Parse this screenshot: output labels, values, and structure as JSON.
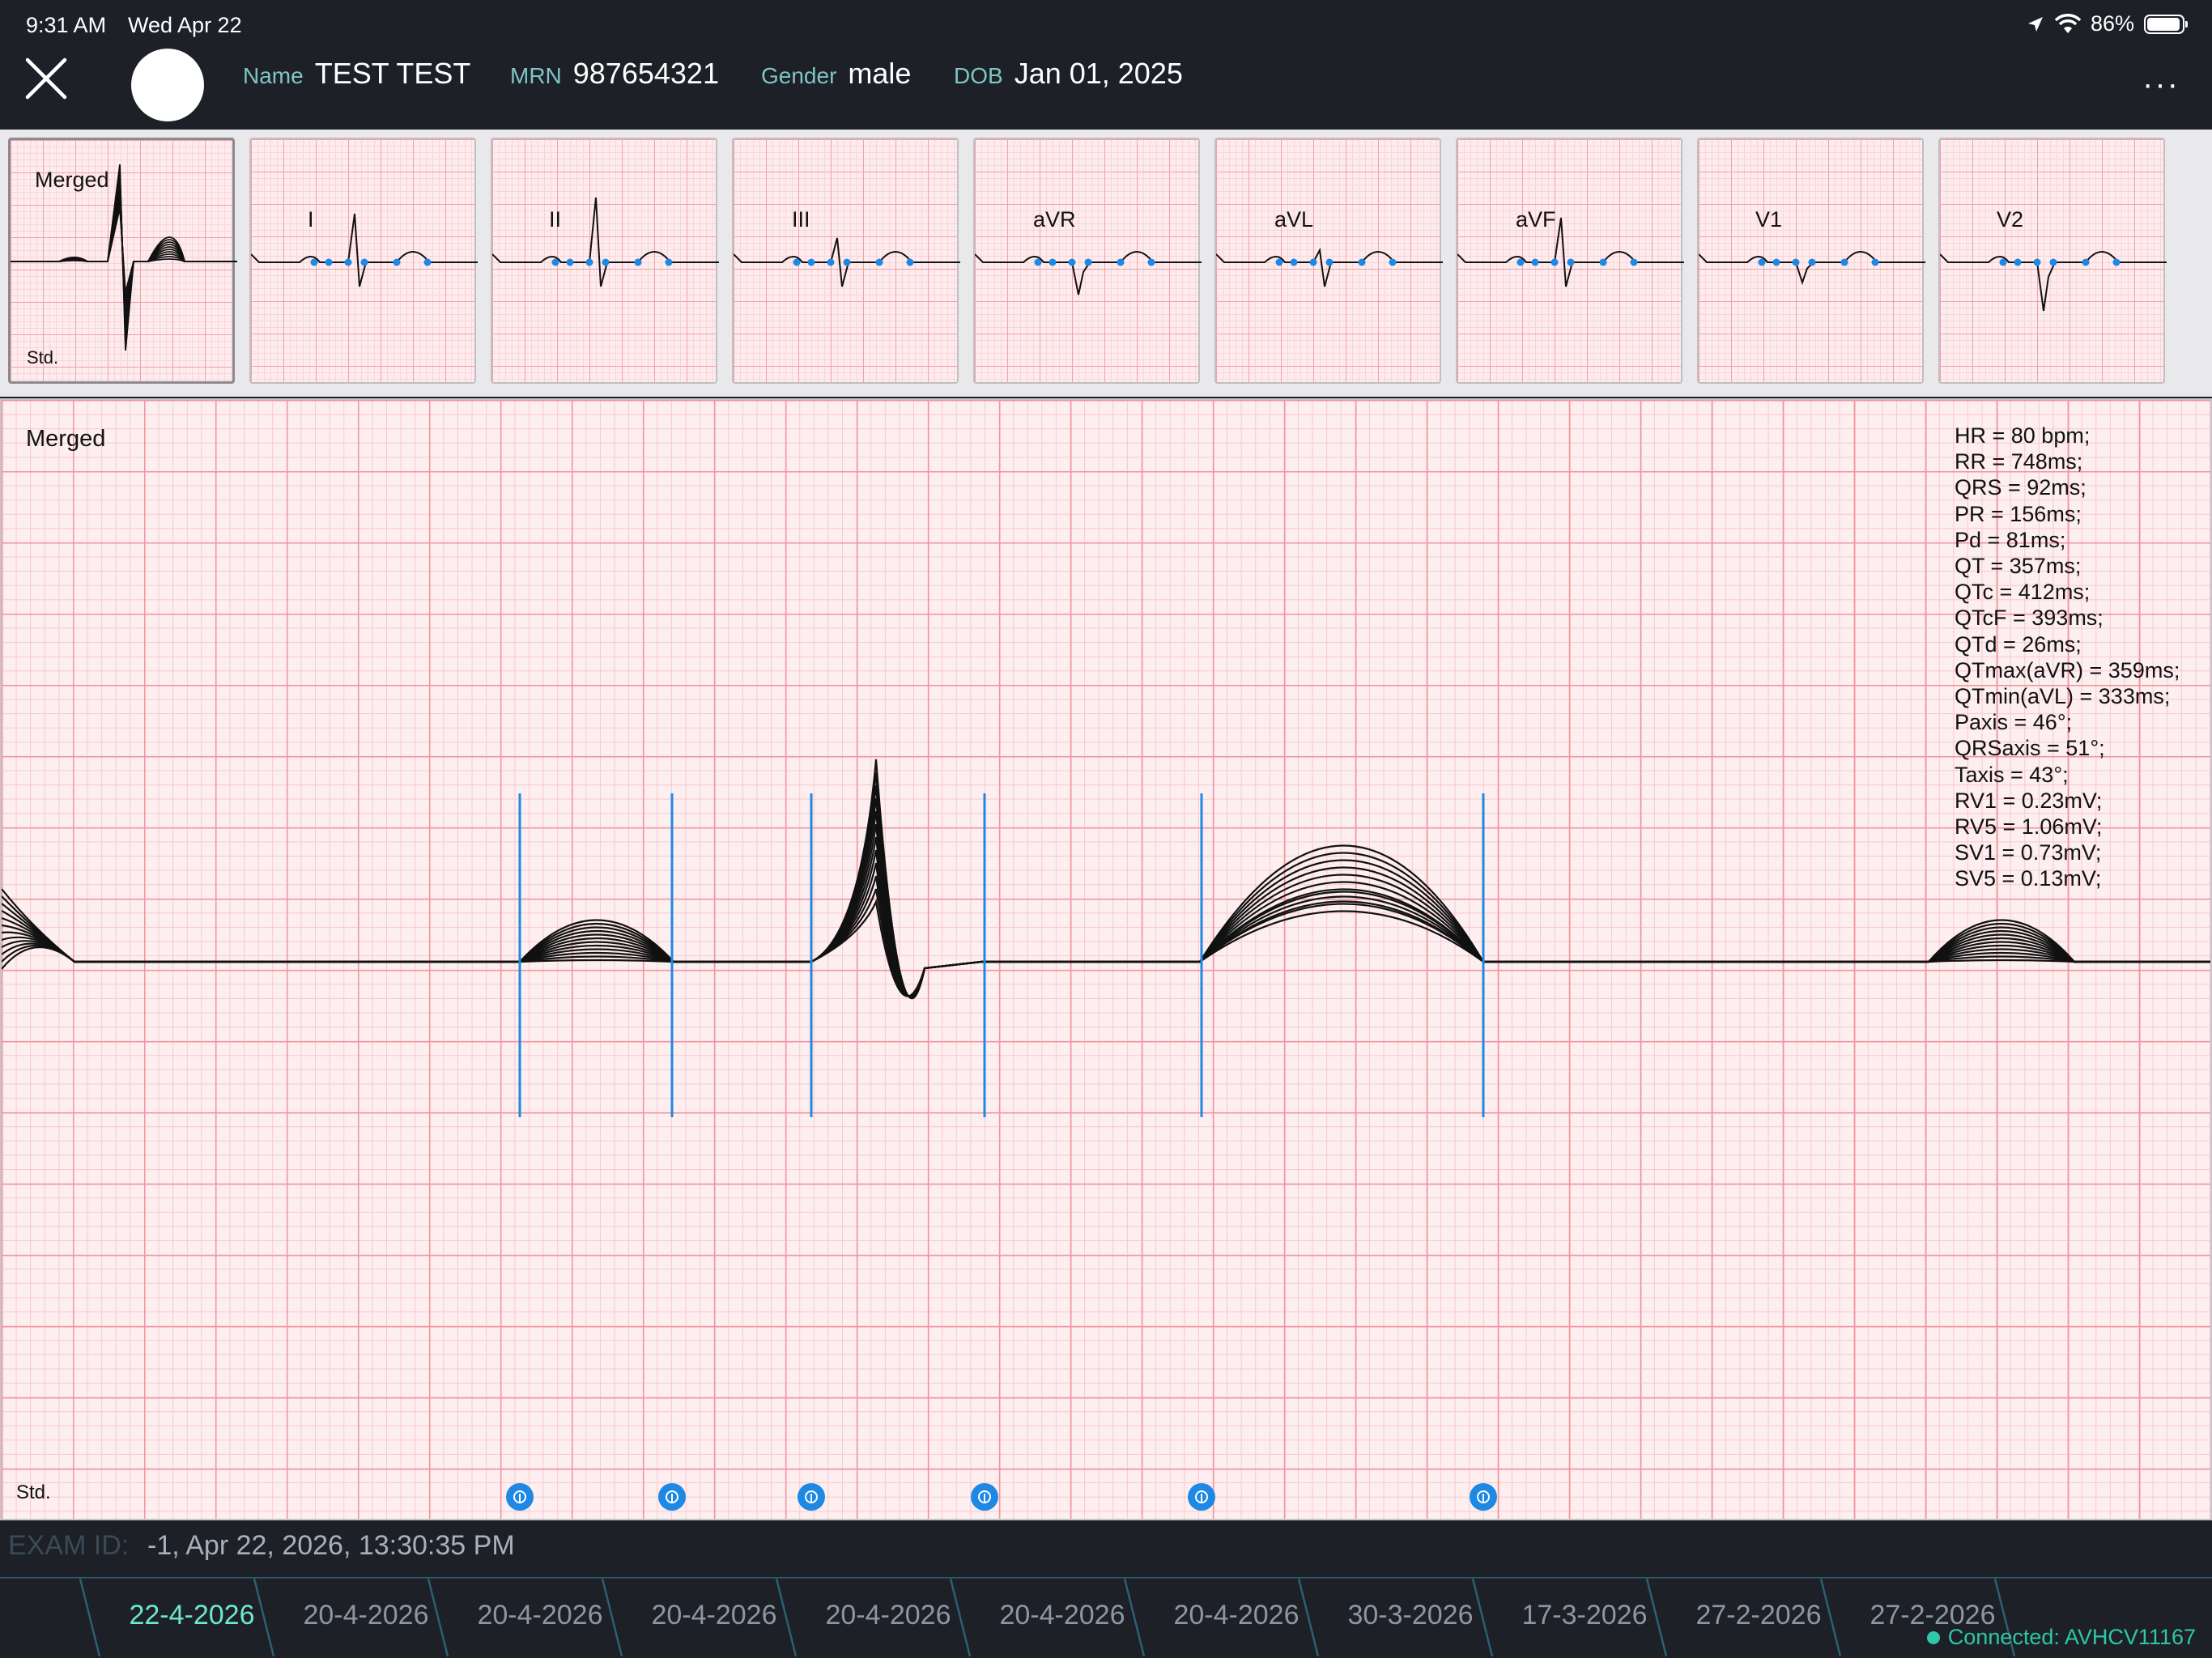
{
  "status_bar": {
    "time": "9:31 AM",
    "date": "Wed Apr 22",
    "battery_text": "86%",
    "battery_level": 0.86
  },
  "header": {
    "name_label": "Name",
    "name_value": "TEST TEST",
    "mrn_label": "MRN",
    "mrn_value": "987654321",
    "gender_label": "Gender",
    "gender_value": "male",
    "dob_label": "DOB",
    "dob_value": "Jan 01, 2025",
    "more_glyph": "···"
  },
  "leads": [
    {
      "label": "Merged",
      "std": "Std.",
      "selected": true
    },
    {
      "label": "I"
    },
    {
      "label": "II"
    },
    {
      "label": "III"
    },
    {
      "label": "aVR"
    },
    {
      "label": "aVL"
    },
    {
      "label": "aVF"
    },
    {
      "label": "V1"
    },
    {
      "label": "V2"
    }
  ],
  "main_view": {
    "label": "Merged",
    "std": "Std.",
    "measurements": [
      "HR = 80 bpm;",
      "RR = 748ms;",
      "QRS = 92ms;",
      "PR = 156ms;",
      "Pd = 81ms;",
      "QT = 357ms;",
      "QTc = 412ms;",
      "QTcF = 393ms;",
      "QTd = 26ms;",
      "QTmax(aVR) = 359ms;",
      "QTmin(aVL) = 333ms;",
      "Paxis = 46°;",
      "QRSaxis = 51°;",
      "Taxis = 43°;",
      "RV1 = 0.23mV;",
      "RV5 = 1.06mV;",
      "SV1 = 0.73mV;",
      "SV5 = 0.13mV;"
    ]
  },
  "exam": {
    "id_label": "EXAM ID:",
    "id_value": "-1,  Apr 22, 2026, 13:30:35 PM"
  },
  "tabs": [
    {
      "label": "22-4-2026",
      "active": true
    },
    {
      "label": "20-4-2026"
    },
    {
      "label": "20-4-2026"
    },
    {
      "label": "20-4-2026"
    },
    {
      "label": "20-4-2026"
    },
    {
      "label": "20-4-2026"
    },
    {
      "label": "20-4-2026"
    },
    {
      "label": "30-3-2026"
    },
    {
      "label": "17-3-2026"
    },
    {
      "label": "27-2-2026"
    },
    {
      "label": "27-2-2026"
    }
  ],
  "connection": {
    "text": "Connected: AVHCV11167"
  },
  "colors": {
    "background": "#1d2027",
    "accent": "#6ee7cf",
    "marker": "#1e88e5",
    "grid_major": "#f1959e",
    "grid_minor": "#f8c8cd",
    "connected": "#2ec7a8"
  },
  "icons": [
    "close-icon",
    "avatar",
    "location-icon",
    "wifi-icon",
    "battery-icon",
    "more-icon",
    "cursor-handle"
  ]
}
